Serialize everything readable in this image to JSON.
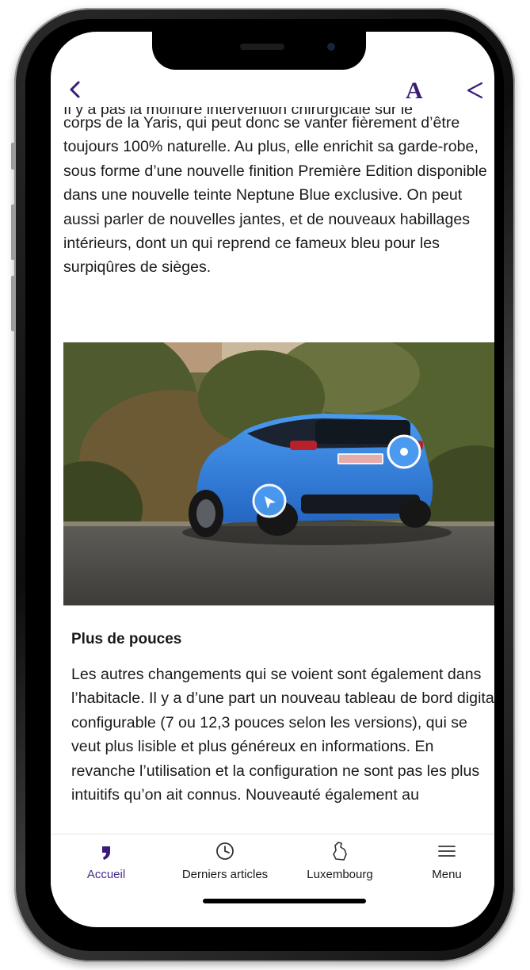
{
  "header": {
    "font_button_label": "A"
  },
  "article": {
    "partial_line": "Il y a pas la moindre intervention chirurgicale sur le",
    "paragraph_1": "corps de la Yaris, qui peut donc se vanter fièrement d’être toujours 100% naturelle. Au plus, elle enrichit sa garde-robe, sous forme d’une nouvelle finition Première Edition disponible dans une nouvelle teinte Neptune Blue exclusive. On peut aussi parler de nouvelles jantes, et de nouveaux habillages intérieurs, dont un qui reprend ce fameux bleu pour les surpiqûres de sièges.",
    "section_heading": "Plus de pouces",
    "paragraph_2": "Les autres changements qui se voient sont également dans l’habitacle. Il y a d’une part un nouveau tableau de bord digital configurable (7 ou 12,3 pouces selon les versions), qui se veut plus lisible et plus généreux en informations. En revanche l’utilisation et la configuration ne sont pas les plus intuitifs qu’on ait connus. Nouveauté également au"
  },
  "tabs": [
    {
      "label": "Accueil",
      "icon": "comma-logo-icon",
      "active": true
    },
    {
      "label": "Derniers articles",
      "icon": "clock-icon",
      "active": false
    },
    {
      "label": "Luxembourg",
      "icon": "luxembourg-map-icon",
      "active": false
    },
    {
      "label": "Menu",
      "icon": "hamburger-menu-icon",
      "active": false
    }
  ],
  "colors": {
    "accent": "#3b1a78",
    "car_blue": "#2f7fd6",
    "text": "#1a1a1a"
  }
}
